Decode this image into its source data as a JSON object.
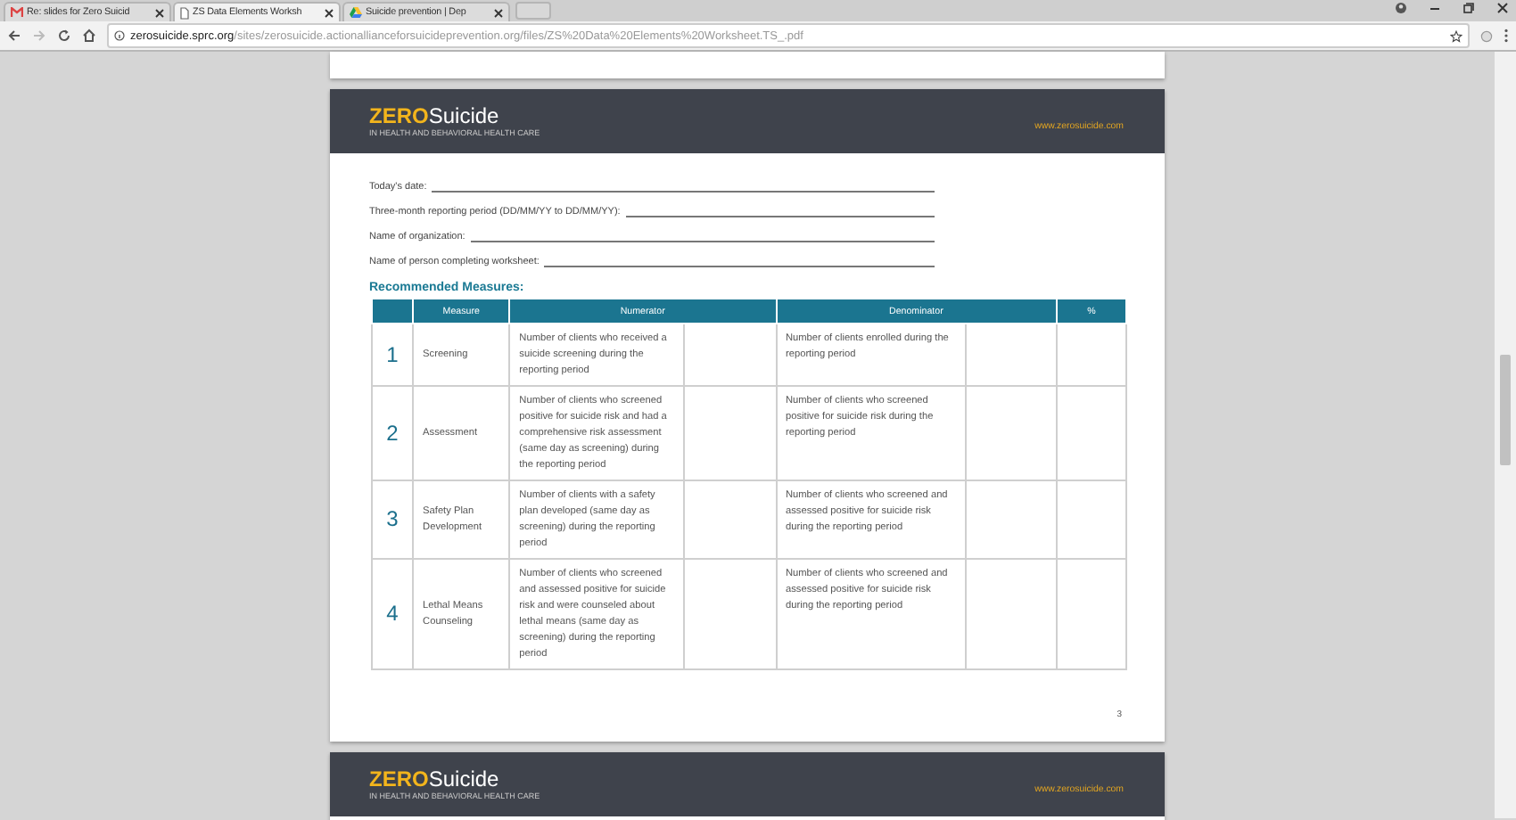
{
  "browser": {
    "tabs": [
      {
        "kind": "mail",
        "title": "Re: slides for Zero Suicid",
        "selected": false
      },
      {
        "kind": "document",
        "title": "ZS Data Elements Worksh",
        "selected": true
      },
      {
        "kind": "drive",
        "title": "Suicide prevention | Dep",
        "selected": false
      }
    ],
    "address_bar": {
      "url": "**zerosuicide.sprc.org**/sites/zerosuicide.actionallianceforsuicideprevention.org/files/ZS%20Data%20Elements%20Worksheet.TS_.pdf"
    }
  },
  "pages": [
    {
      "header": {
        "logo": "**ZERO**Suicide",
        "tagline": "IN HEALTH AND BEHAVIORAL HEALTH CARE",
        "website": "www.zerosuicide.com"
      },
      "fields": [
        {
          "label": "Today's date:"
        },
        {
          "label": "Three-month reporting period (DD/MM/YY to DD/MM/YY):"
        },
        {
          "label": "Name of organization:"
        },
        {
          "label": "Name of person completing worksheet:"
        }
      ],
      "section_title": "Recommended Measures:",
      "table": {
        "columns": [
          "Measure",
          "Numerator",
          "Denominator",
          "%"
        ],
        "rows": [
          {
            "number": "1",
            "measure": "Screening",
            "numerator": "Number of clients who received a suicide screening during the reporting period",
            "denominator": "Number of clients enrolled during the reporting period"
          },
          {
            "number": "2",
            "measure": "Assessment",
            "numerator": "Number of clients who screened positive for suicide risk and had a comprehensive risk assessment (same day as screening) during the reporting period",
            "denominator": "Number of clients who screened positive for suicide risk during the reporting period"
          },
          {
            "number": "3",
            "measure": "Safety Plan Development",
            "numerator": "Number of clients with a safety plan developed (same day as screening) during the reporting period",
            "denominator": "Number of clients who screened and assessed positive for suicide risk during the reporting period"
          },
          {
            "number": "4",
            "measure": "Lethal Means Counseling",
            "numerator": "Number of clients who screened and assessed positive for suicide risk and were counseled about lethal means (same day as screening) during the reporting period",
            "denominator": "Number of clients who screened and assessed positive for suicide risk during the reporting period"
          }
        ]
      },
      "page_number": "3"
    },
    {
      "header": {
        "logo": "**ZERO**Suicide",
        "tagline": "IN HEALTH AND BEHAVIORAL HEALTH CARE",
        "website": "www.zerosuicide.com"
      }
    }
  ]
}
